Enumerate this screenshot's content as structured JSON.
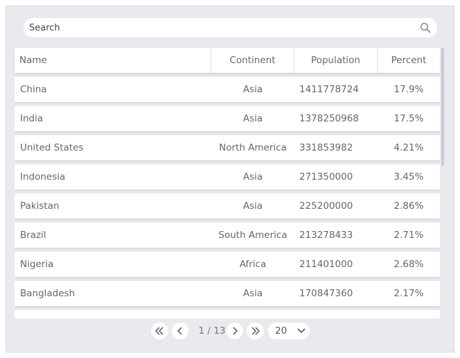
{
  "search": {
    "placeholder": "Search"
  },
  "table": {
    "columns": [
      "Name",
      "Continent",
      "Population",
      "Percent"
    ],
    "rows": [
      {
        "name": "China",
        "continent": "Asia",
        "population": "1411778724",
        "percent": "17.9%"
      },
      {
        "name": "India",
        "continent": "Asia",
        "population": "1378250968",
        "percent": "17.5%"
      },
      {
        "name": "United States",
        "continent": "North America",
        "population": "331853982",
        "percent": "4.21%"
      },
      {
        "name": "Indonesia",
        "continent": "Asia",
        "population": "271350000",
        "percent": "3.45%"
      },
      {
        "name": "Pakistan",
        "continent": "Asia",
        "population": "225200000",
        "percent": "2.86%"
      },
      {
        "name": "Brazil",
        "continent": "South America",
        "population": "213278433",
        "percent": "2.71%"
      },
      {
        "name": "Nigeria",
        "continent": "Africa",
        "population": "211401000",
        "percent": "2.68%"
      },
      {
        "name": "Bangladesh",
        "continent": "Asia",
        "population": "170847360",
        "percent": "2.17%"
      },
      {
        "name": "",
        "continent": "",
        "population": "",
        "percent": ""
      }
    ]
  },
  "pagination": {
    "page_text": "1 / 13",
    "page_size": "20",
    "icons": [
      "first-page-icon",
      "prev-page-icon",
      "next-page-icon",
      "last-page-icon",
      "chevron-down-icon"
    ]
  },
  "colors": {
    "background": "#e9eaee",
    "surface": "#ffffff",
    "text": "#666666"
  }
}
